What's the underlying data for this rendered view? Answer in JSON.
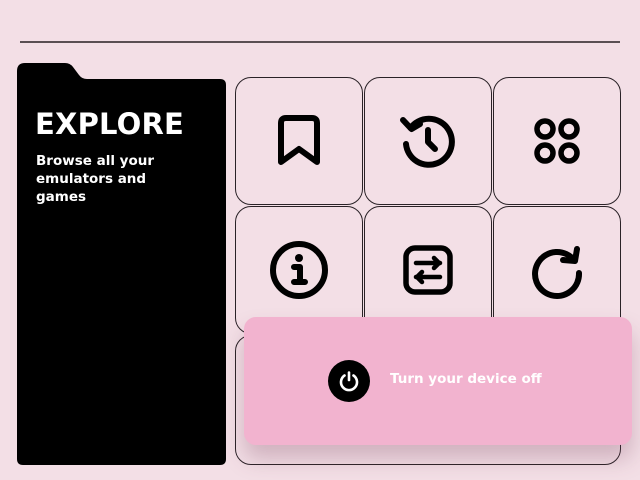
{
  "explore": {
    "title": "EXPLORE",
    "description": "Browse all your emulators and games"
  },
  "grid": {
    "items": [
      {
        "icon": "bookmark-icon"
      },
      {
        "icon": "history-icon"
      },
      {
        "icon": "apps-grid-icon"
      },
      {
        "icon": "info-icon"
      },
      {
        "icon": "settings-sliders-icon"
      },
      {
        "icon": "refresh-icon"
      }
    ]
  },
  "power": {
    "label": "Turn your device off",
    "icon": "power-icon"
  },
  "colors": {
    "background": "#f3dfe6",
    "folder": "#000000",
    "power_card": "#f2b3cf",
    "outline": "#2a2227"
  }
}
